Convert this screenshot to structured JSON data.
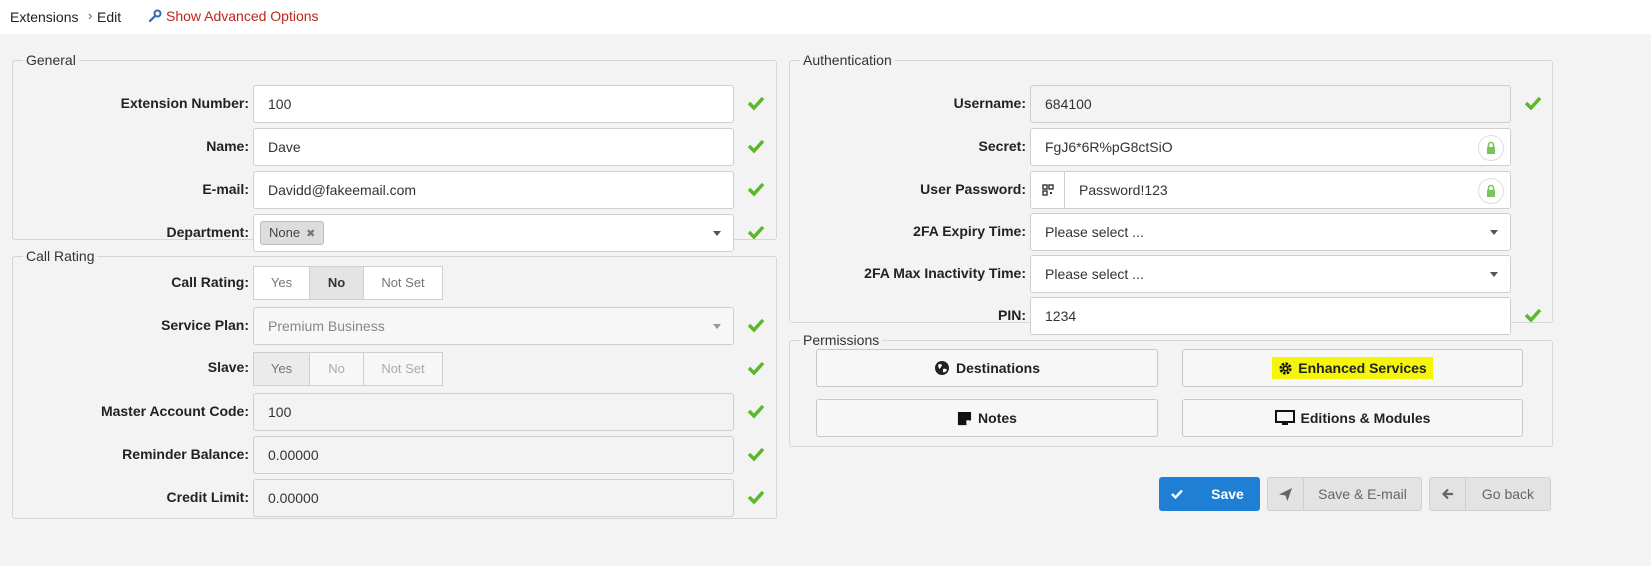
{
  "breadcrumb": {
    "root": "Extensions",
    "current": "Edit"
  },
  "advanced_link": "Show Advanced Options",
  "general": {
    "legend": "General",
    "extension_number": {
      "label": "Extension Number:",
      "value": "100"
    },
    "name": {
      "label": "Name:",
      "value": "Dave"
    },
    "email": {
      "label": "E-mail:",
      "value": "Davidd@fakeemail.com"
    },
    "department": {
      "label": "Department:",
      "tag": "None",
      "tag_remove": "✖"
    }
  },
  "call_rating": {
    "legend": "Call Rating",
    "call_rating": {
      "label": "Call Rating:",
      "options": [
        "Yes",
        "No",
        "Not Set"
      ],
      "selected": "No"
    },
    "service_plan": {
      "label": "Service Plan:",
      "value": "Premium Business"
    },
    "slave": {
      "label": "Slave:",
      "options": [
        "Yes",
        "No",
        "Not Set"
      ],
      "selected": "Yes"
    },
    "master_account_code": {
      "label": "Master Account Code:",
      "value": "100"
    },
    "reminder_balance": {
      "label": "Reminder Balance:",
      "value": "0.00000"
    },
    "credit_limit": {
      "label": "Credit Limit:",
      "value": "0.00000"
    }
  },
  "authentication": {
    "legend": "Authentication",
    "username": {
      "label": "Username:",
      "value": "684100"
    },
    "secret": {
      "label": "Secret:",
      "value": "FgJ6*6R%pG8ctSiO"
    },
    "user_password": {
      "label": "User Password:",
      "value": "Password!123"
    },
    "tfa_expiry": {
      "label": "2FA Expiry Time:",
      "placeholder": "Please select ..."
    },
    "tfa_inactivity": {
      "label": "2FA Max Inactivity Time:",
      "placeholder": "Please select ..."
    },
    "pin": {
      "label": "PIN:",
      "value": "1234"
    }
  },
  "permissions": {
    "legend": "Permissions",
    "destinations": "Destinations",
    "enhanced_services": "Enhanced Services",
    "notes": "Notes",
    "editions_modules": "Editions & Modules"
  },
  "actions": {
    "save": "Save",
    "save_email": "Save & E-mail",
    "go_back": "Go back"
  },
  "colors": {
    "check": "#5bb82a",
    "primary": "#1f7fd4",
    "link": "#c0241c",
    "highlight": "#f5f50a"
  }
}
